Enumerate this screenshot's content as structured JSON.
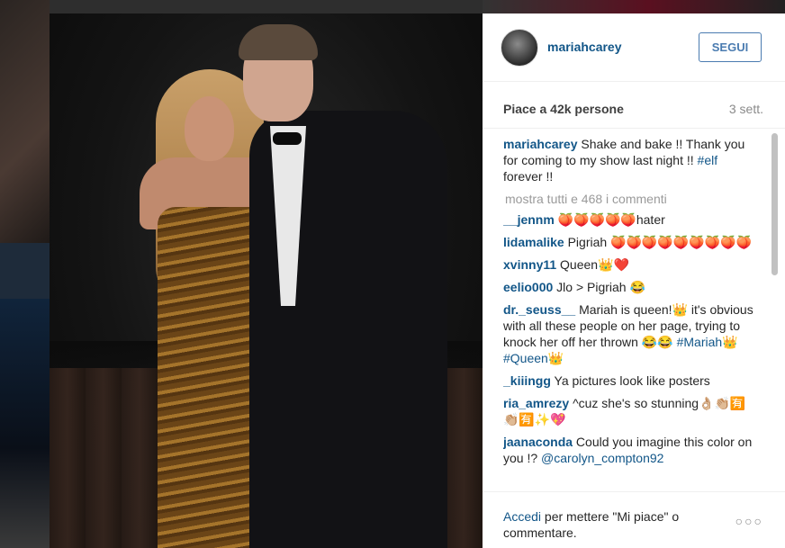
{
  "post": {
    "username": "mariahcarey",
    "follow_label": "SEGUI",
    "likes_text": "Piace a 42k persone",
    "time_ago": "3 sett.",
    "caption": {
      "user": "mariahcarey",
      "text": "Shake and bake !! Thank you for coming to my show last night !!",
      "hashtag": "#elf",
      "suffix": "forever !!"
    },
    "view_all_comments": "mostra tutti e 468 i commenti",
    "comments": [
      {
        "user": "__jennm",
        "text": "🍑🍑🍑🍑🍑hater"
      },
      {
        "user": "lidamalike",
        "text": "Pigriah 🍑🍑🍑🍑🍑🍑🍑🍑🍑"
      },
      {
        "user": "xvinny11",
        "text": "Queen👑❤️"
      },
      {
        "user": "eelio000",
        "text": "Jlo > Pigriah 😂"
      },
      {
        "user": "dr._seuss__",
        "text": "Mariah is queen!👑 it's obvious with all these people on her page, trying to knock her off her thrown 😂😂",
        "tags": [
          "#Mariah👑",
          "#Queen👑"
        ]
      },
      {
        "user": "_kiiingg",
        "text": "Ya pictures look like posters"
      },
      {
        "user": "ria_amrezy",
        "text": "^cuz she's so stunning👌🏼👏🏼🈶👏🏼🈶✨💖"
      },
      {
        "user": "jaanaconda",
        "text": "Could you imagine this color on you !?",
        "mention": "@carolyn_compton92"
      }
    ],
    "footer": {
      "link": "Accedi",
      "text": "per mettere \"Mi piace\" o commentare.",
      "more": "○○○"
    }
  }
}
